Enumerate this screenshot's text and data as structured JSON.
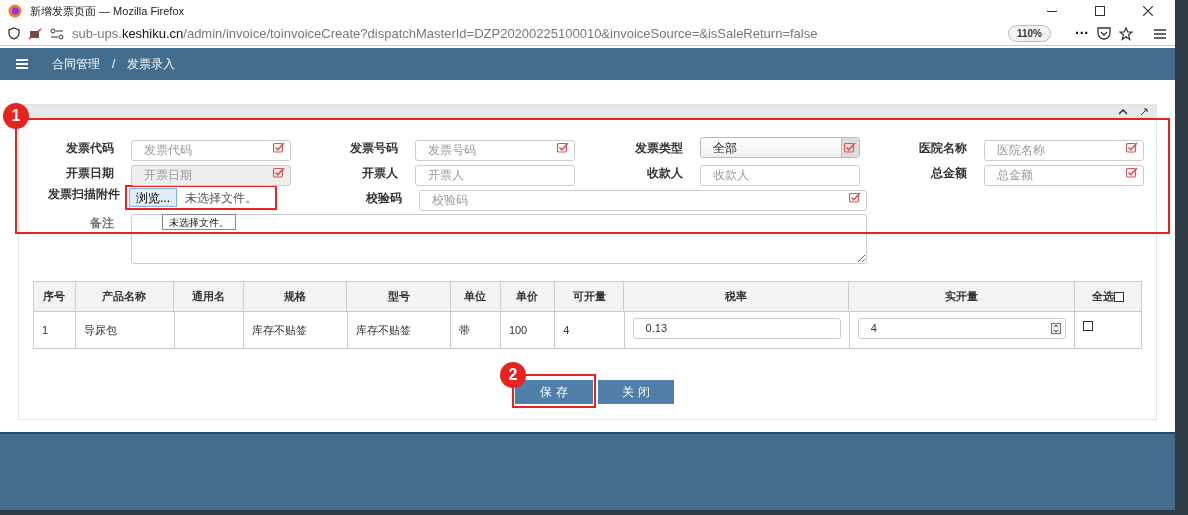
{
  "window": {
    "title": "新增发票页面 — Mozilla Firefox"
  },
  "url_bar": {
    "url_prefix": "sub-ups.",
    "url_domain": "keshiku.cn",
    "url_rest": "/admin/invoice/toinvoiceCreate?dispatchMasterId=DZP20200225100010&invoiceSource=&isSaleReturn=false",
    "zoom": "110%",
    "more": "···"
  },
  "breadcrumb": [
    "合同管理",
    "/",
    "发票录入"
  ],
  "form": {
    "fields": [
      {
        "kind": "text",
        "label": "发票代码",
        "placeholder": "发票代码",
        "required": true,
        "disabled": false
      },
      {
        "kind": "text",
        "label": "发票号码",
        "placeholder": "发票号码",
        "required": true,
        "disabled": false
      },
      {
        "kind": "select",
        "label": "发票类型",
        "value": "全部",
        "required": true,
        "disabled": false
      },
      {
        "kind": "text",
        "label": "医院名称",
        "placeholder": "医院名称",
        "required": true,
        "disabled": false
      },
      {
        "kind": "text",
        "label": "开票日期",
        "placeholder": "开票日期",
        "required": true,
        "disabled": true
      },
      {
        "kind": "text",
        "label": "开票人",
        "placeholder": "开票人",
        "required": false,
        "disabled": false
      },
      {
        "kind": "text",
        "label": "收款人",
        "placeholder": "收款人",
        "required": false,
        "disabled": false
      },
      {
        "kind": "text",
        "label": "总金额",
        "placeholder": "总金额",
        "required": true,
        "disabled": false
      },
      {
        "kind": "file",
        "label": "发票扫描附件",
        "button": "浏览...",
        "value": "未选择文件。",
        "tooltip": "未选择文件。"
      },
      {
        "kind": "wide",
        "label": "校验码",
        "placeholder": "校验码",
        "required": true,
        "disabled": false
      },
      {
        "kind": "textarea",
        "label": "备注"
      }
    ]
  },
  "table": {
    "columns": [
      "序号",
      "产品名称",
      "通用名",
      "规格",
      "型号",
      "单位",
      "单价",
      "可开量",
      "税率",
      "实开量",
      "全选"
    ],
    "select_all_checked": false,
    "rows": [
      {
        "cells": [
          "1",
          "导尿包",
          "",
          "库存不贴签",
          "库存不贴签",
          "带",
          "100",
          "4"
        ],
        "tax_rate": "0.13",
        "quantity": "4",
        "checked": false
      }
    ]
  },
  "buttons": [
    {
      "label": "保 存",
      "kind": "save"
    },
    {
      "label": "关 闭",
      "kind": "close"
    }
  ],
  "annotations": [
    "1",
    "2"
  ]
}
